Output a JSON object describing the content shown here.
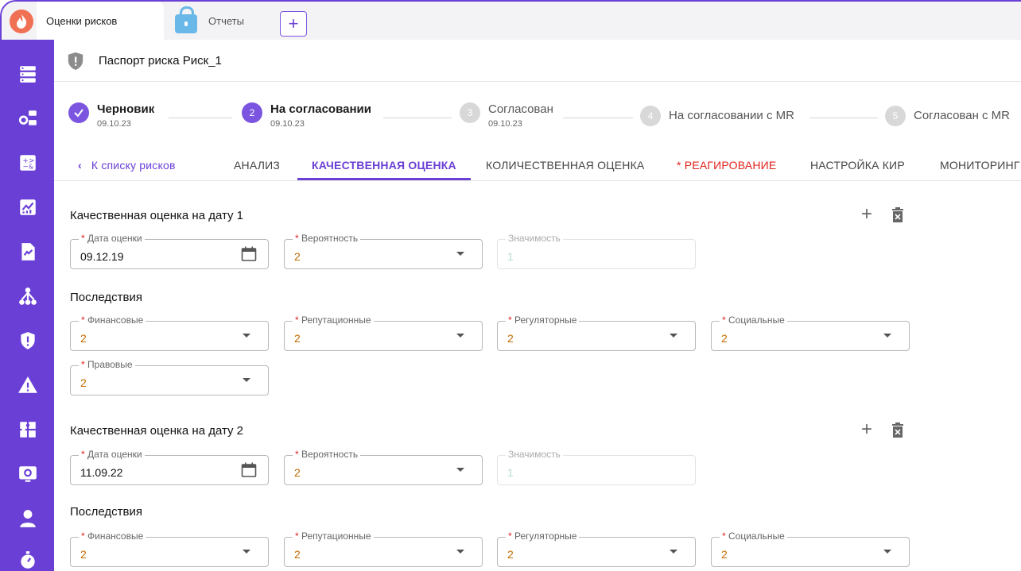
{
  "tabs": {
    "active_label": "Оценки рисков",
    "reports_label": "Отчеты",
    "add_symbol": "+"
  },
  "header": {
    "title": "Паспорт риска Риск_1"
  },
  "stepper": [
    {
      "num": "",
      "label": "Черновик",
      "date": "09.10.23",
      "state": "done"
    },
    {
      "num": "2",
      "label": "На согласовании",
      "date": "09.10.23",
      "state": "active"
    },
    {
      "num": "3",
      "label": "Согласован",
      "date": "09.10.23",
      "state": "todo"
    },
    {
      "num": "4",
      "label": "На согласовании с MR",
      "date": "",
      "state": "todo"
    },
    {
      "num": "5",
      "label": "Согласован с MR",
      "date": "",
      "state": "todo"
    }
  ],
  "nav": {
    "back": "К списку рисков",
    "items": [
      "АНАЛИЗ",
      "КАЧЕСТВЕННАЯ ОЦЕНКА",
      "КОЛИЧЕСТВЕННАЯ ОЦЕНКА",
      "* РЕАГИРОВАНИЕ",
      "НАСТРОЙКА КИР",
      "МОНИТОРИНГ"
    ]
  },
  "sections": [
    {
      "title": "Качественная оценка на дату 1",
      "date_label": "Дата оценки",
      "date_value": "09.12.19",
      "prob_label": "Вероятность",
      "prob_value": "2",
      "sig_label": "Значимость",
      "sig_value": "1",
      "consequences_title": "Последствия",
      "fields": [
        {
          "label": "Финансовые",
          "value": "2"
        },
        {
          "label": "Репутационные",
          "value": "2"
        },
        {
          "label": "Регуляторные",
          "value": "2"
        },
        {
          "label": "Социальные",
          "value": "2"
        },
        {
          "label": "Правовые",
          "value": "2"
        }
      ]
    },
    {
      "title": "Качественная оценка на дату 2",
      "date_label": "Дата оценки",
      "date_value": "11.09.22",
      "prob_label": "Вероятность",
      "prob_value": "2",
      "sig_label": "Значимость",
      "sig_value": "1",
      "consequences_title": "Последствия",
      "fields": [
        {
          "label": "Финансовые",
          "value": "2"
        },
        {
          "label": "Репутационные",
          "value": "2"
        },
        {
          "label": "Регуляторные",
          "value": "2"
        },
        {
          "label": "Социальные",
          "value": "2"
        }
      ]
    }
  ],
  "required_mark": "*",
  "colors": {
    "accent": "#6a3fd6",
    "value": "#c36a00",
    "warning": "#e0241d"
  }
}
